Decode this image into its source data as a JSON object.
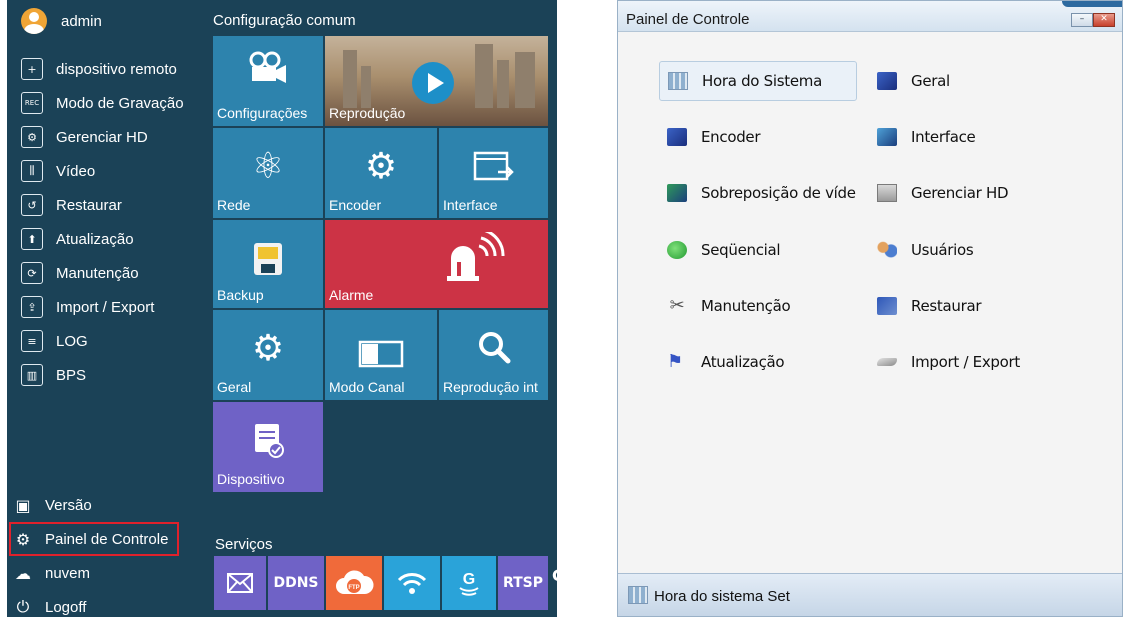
{
  "dvr": {
    "user": "admin",
    "menu": [
      {
        "label": "dispositivo remoto",
        "icon": "remote-device-icon",
        "glyph": "+"
      },
      {
        "label": "Modo de Gravação",
        "icon": "record-icon",
        "glyph": "REC"
      },
      {
        "label": "Gerenciar HD",
        "icon": "hdd-icon",
        "glyph": "⚙"
      },
      {
        "label": "Vídeo",
        "icon": "video-sliders-icon",
        "glyph": "⫼"
      },
      {
        "label": "Restaurar",
        "icon": "restore-icon",
        "glyph": "↺"
      },
      {
        "label": "Atualização",
        "icon": "upgrade-icon",
        "glyph": "⬆"
      },
      {
        "label": "Manutenção",
        "icon": "maintenance-icon",
        "glyph": "⟳"
      },
      {
        "label": "Import / Export",
        "icon": "import-export-icon",
        "glyph": "⇪"
      },
      {
        "label": "LOG",
        "icon": "log-icon",
        "glyph": "≡"
      },
      {
        "label": "BPS",
        "icon": "bps-icon",
        "glyph": "▥"
      }
    ],
    "bottom_menu": [
      {
        "label": "Versão",
        "icon": "version-icon",
        "glyph": "▣"
      },
      {
        "label": "Painel de Controle",
        "icon": "gear-icon",
        "glyph": "⚙"
      },
      {
        "label": "nuvem",
        "icon": "cloud-icon",
        "glyph": "☁"
      },
      {
        "label": "Logoff",
        "icon": "power-icon",
        "glyph": "⏻"
      }
    ],
    "common_title": "Configuração comum",
    "tiles": {
      "configuracoes": "Configurações",
      "reproducao": "Reprodução",
      "rede": "Rede",
      "encoder": "Encoder",
      "interface": "Interface",
      "backup": "Backup",
      "alarme": "Alarme",
      "geral": "Geral",
      "modo_canal": "Modo Canal",
      "reproducao_int": "Reprodução int",
      "dispositivo": "Dispositivo"
    },
    "services_title": "Serviços",
    "services": {
      "ddns": "DDNS",
      "rtsp": "RTSP",
      "refresh": "C"
    }
  },
  "panel": {
    "title": "Painel de Controle",
    "btn_min": "–",
    "btn_close": "✕",
    "items_left": [
      "Hora do Sistema",
      "Encoder",
      "Sobreposição de víde",
      "Seqüencial",
      "Manutenção",
      "Atualização"
    ],
    "items_right": [
      "Geral",
      "Interface",
      "Gerenciar HD",
      "Usuários",
      "Restaurar",
      "Import / Export"
    ],
    "status": "Hora do sistema Set"
  }
}
